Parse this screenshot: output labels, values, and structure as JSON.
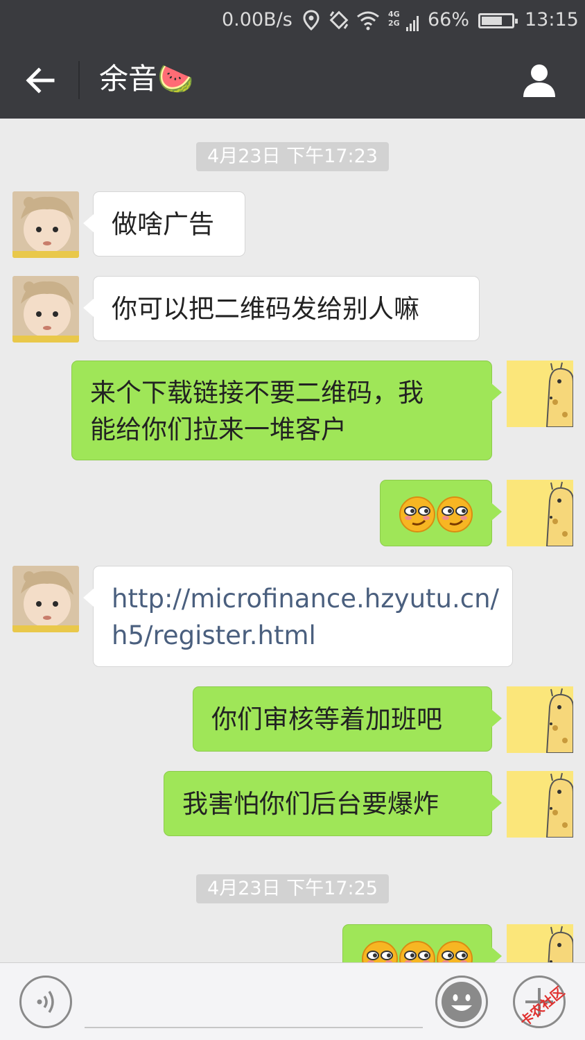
{
  "status_bar": {
    "speed": "0.00B/s",
    "network": "4G 2G",
    "battery_percent_text": "66%",
    "battery_level": 0.66,
    "time": "13:15"
  },
  "header": {
    "back_icon": "arrow-left-icon",
    "title": "余音🍉",
    "profile_icon": "person-icon"
  },
  "messages": [
    {
      "type": "timestamp",
      "text": "4月23日 下午17:23"
    },
    {
      "type": "message",
      "side": "left",
      "text": "做啥广告"
    },
    {
      "type": "message",
      "side": "left",
      "text": "你可以把二维码发给别人嘛"
    },
    {
      "type": "message",
      "side": "right",
      "lines": [
        "来个下载链接不要二维码，我",
        "能给你们拉来一堆客户"
      ]
    },
    {
      "type": "message",
      "side": "right",
      "emoji": [
        "smirk-emoji",
        "smirk-emoji"
      ]
    },
    {
      "type": "message",
      "side": "left",
      "link": true,
      "lines": [
        "http://microfinance.hzyutu.cn/",
        "h5/register.html"
      ]
    },
    {
      "type": "message",
      "side": "right",
      "text": "你们审核等着加班吧"
    },
    {
      "type": "message",
      "side": "right",
      "text": "我害怕你们后台要爆炸"
    },
    {
      "type": "timestamp",
      "text": "4月23日 下午17:25"
    },
    {
      "type": "message",
      "side": "right",
      "emoji": [
        "smirk-emoji",
        "smirk-emoji",
        "smirk-emoji"
      ]
    }
  ],
  "input_bar": {
    "voice_icon": "voice-icon",
    "emoji_icon": "smiley-icon",
    "plus_icon": "plus-icon",
    "watermark": "卡农社区",
    "input_value": ""
  },
  "colors": {
    "bar_bg": "#3a3b3f",
    "chat_bg": "#ebebeb",
    "out_bubble": "#9fe658",
    "in_bubble": "#ffffff",
    "timestamp_bg": "#d2d2d2"
  }
}
